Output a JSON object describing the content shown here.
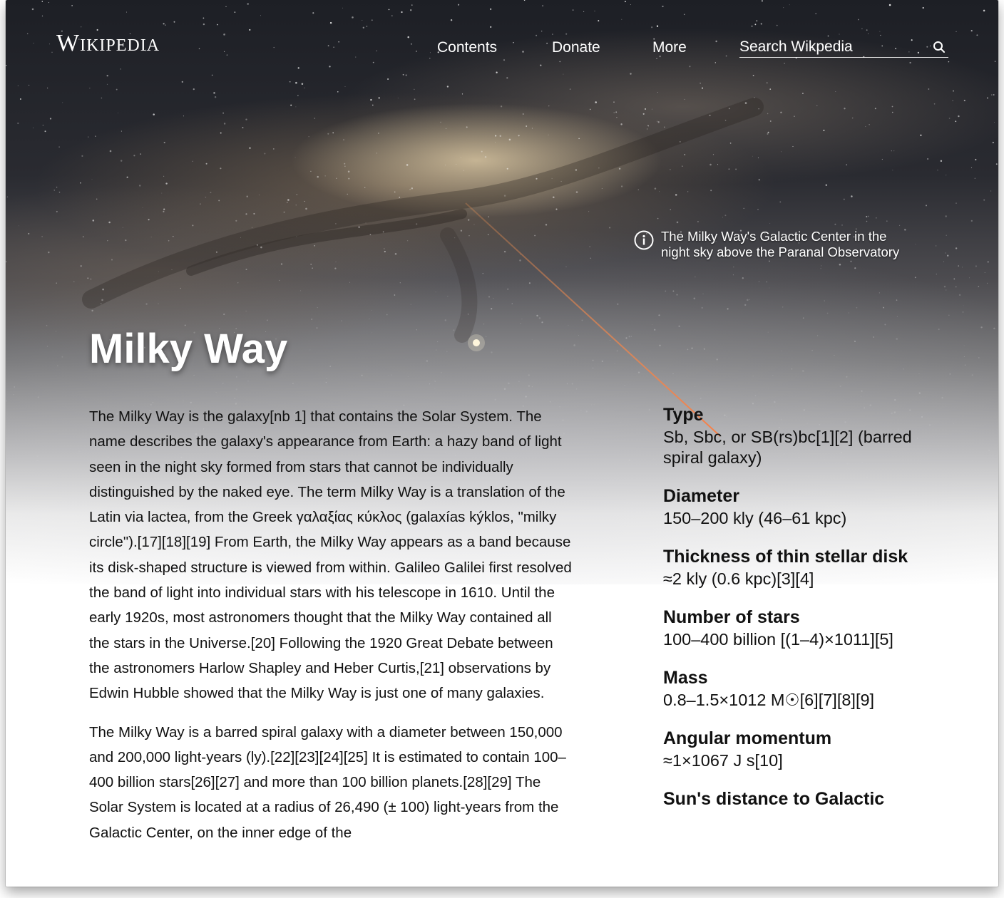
{
  "header": {
    "logo_text": "Wikipedia",
    "nav": {
      "contents": "Contents",
      "donate": "Donate",
      "more": "More"
    },
    "search": {
      "placeholder": "Search Wikpedia",
      "icon": "search-icon"
    }
  },
  "hero": {
    "caption_icon": "info-icon",
    "caption": "The Milky Way's Galactic Center in the night sky above the Paranal Observatory"
  },
  "article": {
    "title": "Milky Way",
    "paragraphs": [
      "The Milky Way is the galaxy[nb 1] that contains the Solar System. The name describes the galaxy's appearance from Earth: a hazy band of light seen in the night sky formed from stars that cannot be individually distinguished by the naked eye. The term Milky Way is a translation of the Latin via lactea, from the Greek γαλαξίας κύκλος (galaxías kýklos, \"milky circle\").[17][18][19] From Earth, the Milky Way appears as a band because its disk-shaped structure is viewed from within. Galileo Galilei first resolved the band of light into individual stars with his telescope in 1610. Until the early 1920s, most astronomers thought that the Milky Way contained all the stars in the Universe.[20] Following the 1920 Great Debate between the astronomers Harlow Shapley and Heber Curtis,[21] observations by Edwin Hubble showed that the Milky Way is just one of many galaxies.",
      "The Milky Way is a barred spiral galaxy with a diameter between 150,000 and 200,000 light-years (ly).[22][23][24][25] It is estimated to contain 100–400 billion stars[26][27] and more than 100 billion planets.[28][29] The Solar System is located at a radius of 26,490 (± 100) light-years from the Galactic Center, on the inner edge of the"
    ]
  },
  "infobox": {
    "items": [
      {
        "label": "Type",
        "value": "Sb, Sbc, or SB(rs)bc[1][2] (barred spiral galaxy)"
      },
      {
        "label": "Diameter",
        "value": "150–200 kly (46–61 kpc)"
      },
      {
        "label": "Thickness of thin stellar disk",
        "value": "≈2 kly (0.6 kpc)[3][4]"
      },
      {
        "label": "Number of stars",
        "value": "100–400 billion [(1–4)×1011][5]"
      },
      {
        "label": "Mass",
        "value": "0.8–1.5×1012 M☉[6][7][8][9]"
      },
      {
        "label": "Angular momentum",
        "value": "≈1×1067 J s[10]"
      },
      {
        "label": "Sun's distance to Galactic",
        "value": ""
      }
    ]
  }
}
